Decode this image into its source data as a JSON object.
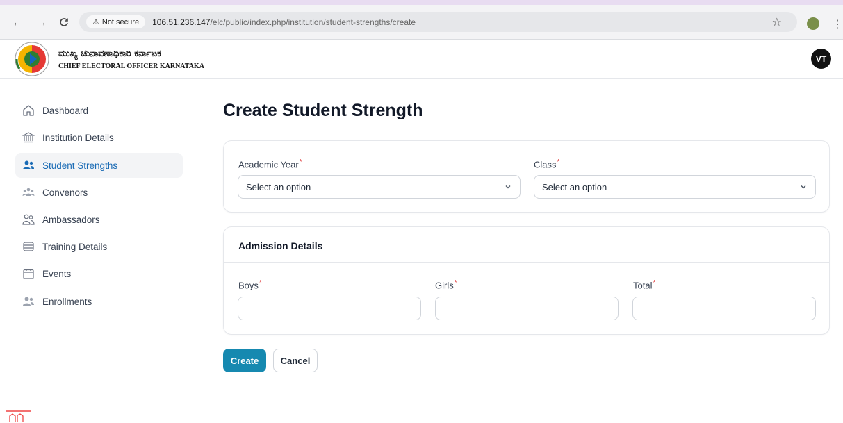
{
  "browser": {
    "security_label": "Not secure",
    "url_host": "106.51.236.147",
    "url_path": "/elc/public/index.php/institution/student-strengths/create"
  },
  "header": {
    "brand_kannada": "ಮುಖ್ಯ ಚುನಾವಣಾಧಿಕಾರಿ ಕರ್ನಾಟಕ",
    "brand_english": "CHIEF ELECTORAL OFFICER KARNATAKA",
    "avatar_initials": "VT"
  },
  "sidebar": {
    "items": [
      {
        "label": "Dashboard",
        "icon": "home-icon"
      },
      {
        "label": "Institution Details",
        "icon": "building-icon"
      },
      {
        "label": "Student Strengths",
        "icon": "users-icon",
        "active": true
      },
      {
        "label": "Convenors",
        "icon": "user-group-icon"
      },
      {
        "label": "Ambassadors",
        "icon": "user-pair-icon"
      },
      {
        "label": "Training Details",
        "icon": "stack-icon"
      },
      {
        "label": "Events",
        "icon": "calendar-icon"
      },
      {
        "label": "Enrollments",
        "icon": "users-icon"
      }
    ]
  },
  "main": {
    "title": "Create Student Strength",
    "academic_year": {
      "label": "Academic Year",
      "placeholder": "Select an option"
    },
    "class": {
      "label": "Class",
      "placeholder": "Select an option"
    },
    "admission": {
      "title": "Admission Details",
      "boys_label": "Boys",
      "girls_label": "Girls",
      "total_label": "Total"
    },
    "create_label": "Create",
    "cancel_label": "Cancel"
  },
  "colors": {
    "accent": "#1689b0",
    "active_nav_text": "#1a6bb5",
    "required": "#dc2626"
  }
}
